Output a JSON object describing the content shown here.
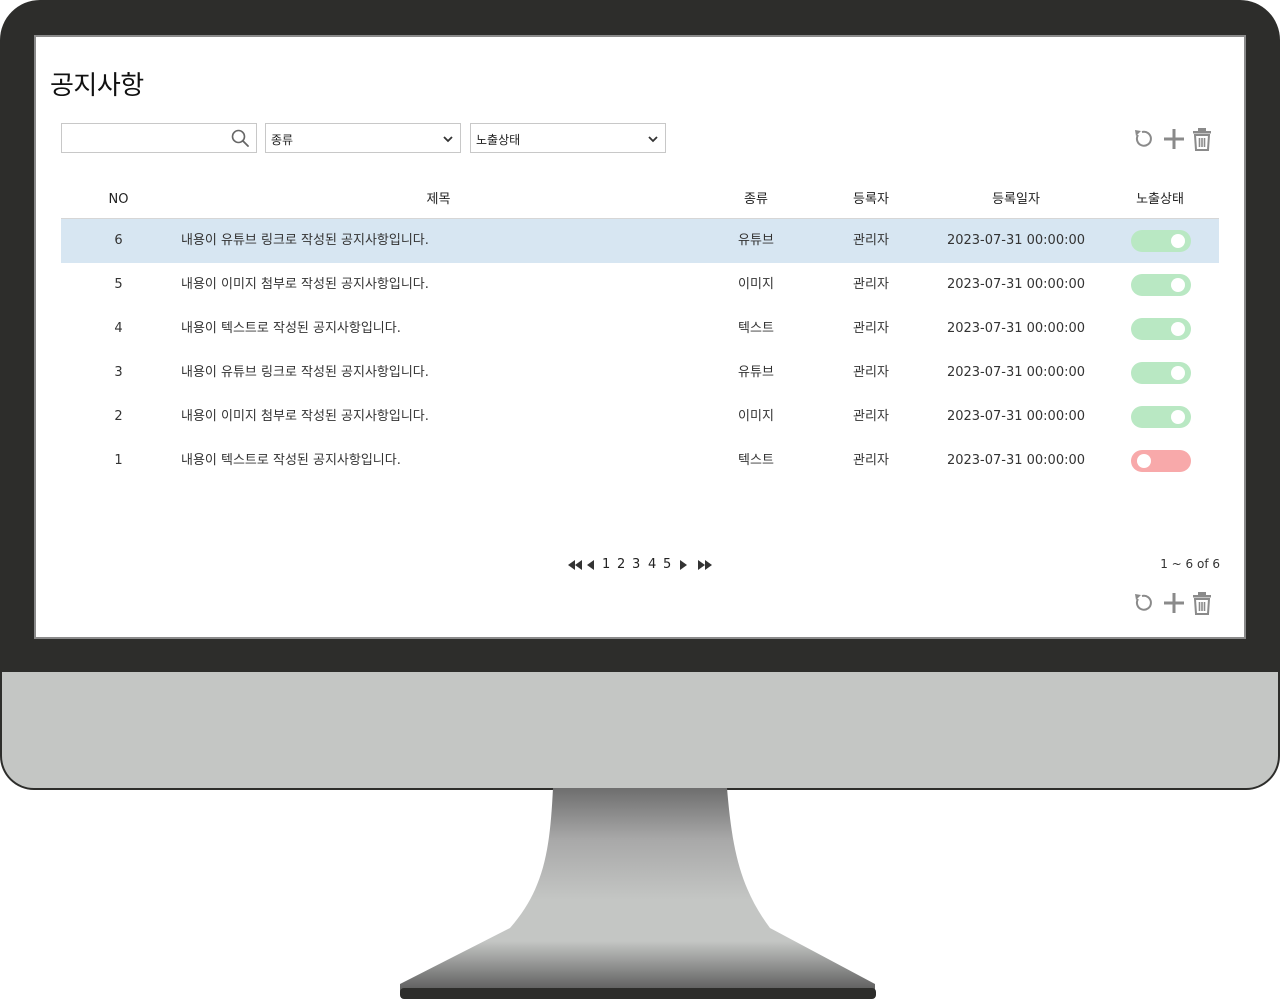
{
  "page": {
    "title": "공지사항"
  },
  "filters": {
    "search_placeholder": "",
    "search_value": "",
    "type_select": "종류",
    "status_select": "노출상태"
  },
  "table": {
    "headers": {
      "no": "NO",
      "title": "제목",
      "type": "종류",
      "author": "등록자",
      "date": "등록일자",
      "status": "노출상태"
    },
    "rows": [
      {
        "no": "6",
        "title": "내용이 유튜브 링크로 작성된 공지사항입니다.",
        "type": "유튜브",
        "author": "관리자",
        "date": "2023-07-31 00:00:00",
        "visible": true,
        "selected": true
      },
      {
        "no": "5",
        "title": "내용이 이미지 첨부로 작성된 공지사항입니다.",
        "type": "이미지",
        "author": "관리자",
        "date": "2023-07-31 00:00:00",
        "visible": true,
        "selected": false
      },
      {
        "no": "4",
        "title": "내용이 텍스트로 작성된 공지사항입니다.",
        "type": "텍스트",
        "author": "관리자",
        "date": "2023-07-31 00:00:00",
        "visible": true,
        "selected": false
      },
      {
        "no": "3",
        "title": "내용이 유튜브 링크로 작성된 공지사항입니다.",
        "type": "유튜브",
        "author": "관리자",
        "date": "2023-07-31 00:00:00",
        "visible": true,
        "selected": false
      },
      {
        "no": "2",
        "title": "내용이 이미지 첨부로 작성된 공지사항입니다.",
        "type": "이미지",
        "author": "관리자",
        "date": "2023-07-31 00:00:00",
        "visible": true,
        "selected": false
      },
      {
        "no": "1",
        "title": "내용이 텍스트로 작성된 공지사항입니다.",
        "type": "텍스트",
        "author": "관리자",
        "date": "2023-07-31 00:00:00",
        "visible": false,
        "selected": false
      }
    ]
  },
  "pagination": {
    "pages": [
      "1",
      "2",
      "3",
      "4",
      "5"
    ],
    "current": "1",
    "summary": "1 ~ 6 of 6"
  },
  "icons": {
    "toolbar": [
      "refresh-icon",
      "plus-icon",
      "trash-icon"
    ],
    "pager": [
      "first-page-icon",
      "prev-page-icon",
      "next-page-icon",
      "last-page-icon"
    ],
    "search": "search-icon",
    "select": "chevron-down-icon"
  },
  "colors": {
    "bezel": "#2d2d2b",
    "selected_row": "#d7e6f2",
    "toggle_on": "#b9e8c3",
    "toggle_off": "#f8a9aa",
    "icon": "#8a8a8a"
  }
}
